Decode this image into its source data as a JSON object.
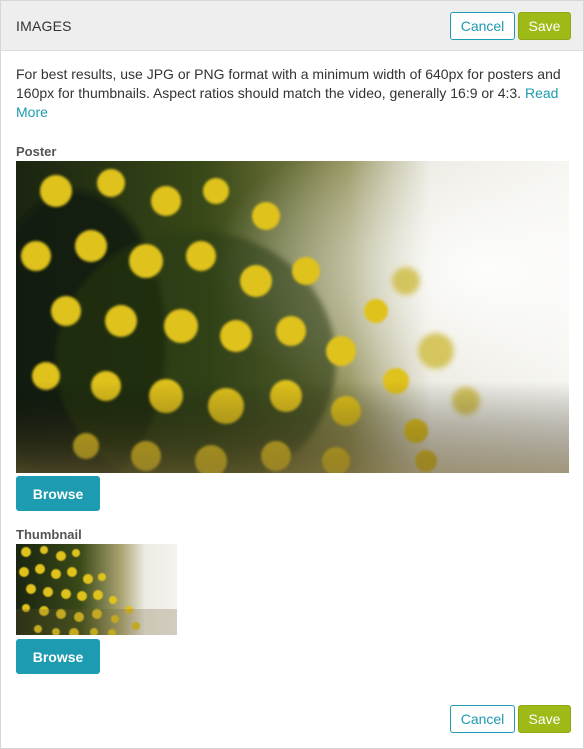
{
  "header": {
    "title": "IMAGES",
    "cancel_label": "Cancel",
    "save_label": "Save"
  },
  "description": {
    "text": "For best results, use JPG or PNG format with a minimum width of 640px for posters and 160px for thumbnails. Aspect ratios should match the video, generally 16:9 or 4:3.",
    "link_label": "Read More"
  },
  "poster": {
    "label": "Poster",
    "browse_label": "Browse"
  },
  "thumbnail": {
    "label": "Thumbnail",
    "browse_label": "Browse"
  },
  "footer": {
    "cancel_label": "Cancel",
    "save_label": "Save"
  },
  "colors": {
    "accent": "#1d9bb0",
    "save": "#9dba16",
    "header_bg": "#eeeeee"
  }
}
